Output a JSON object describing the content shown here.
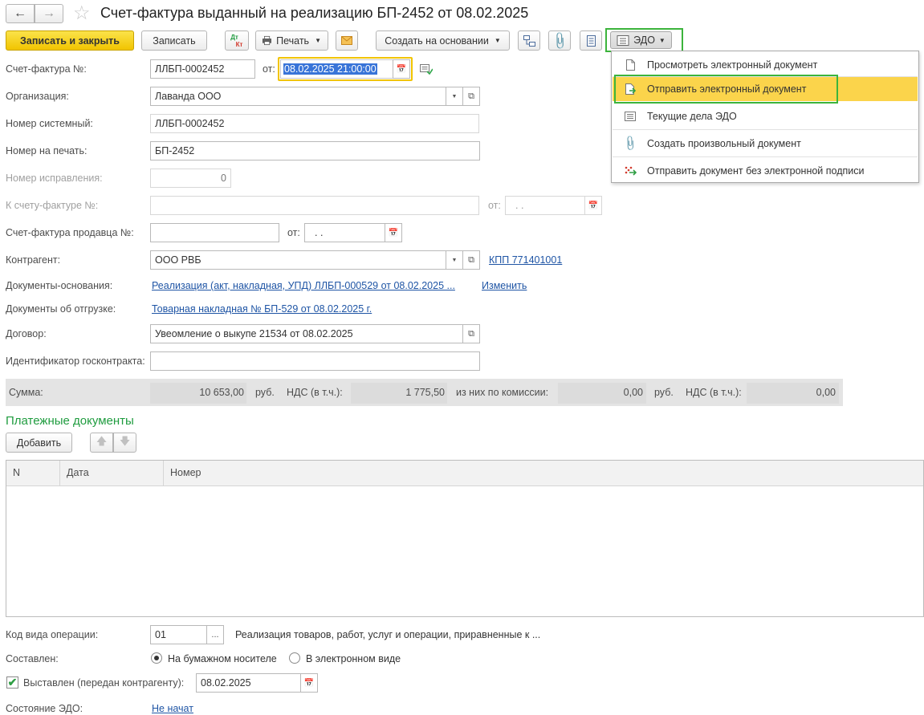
{
  "window": {
    "title": "Счет-фактура выданный на реализацию БП-2452 от 08.02.2025"
  },
  "toolbar": {
    "save_close": "Записать и закрыть",
    "save": "Записать",
    "dt_kt_top": "Дт",
    "dt_kt_bottom": "Кт",
    "print": "Печать",
    "create_based": "Создать на основании",
    "edo": "ЭДО"
  },
  "edo_menu": {
    "items": [
      {
        "label": "Просмотреть электронный документ"
      },
      {
        "label": "Отправить электронный документ"
      },
      {
        "label": "Текущие дела ЭДО"
      },
      {
        "label": "Создать произвольный документ"
      },
      {
        "label": "Отправить документ без электронной подписи"
      }
    ],
    "highlight_color": "#fbd44b",
    "outline_color": "#3cb43c"
  },
  "form": {
    "invoice_no_label": "Счет-фактура №:",
    "invoice_no": "ЛЛБП-0002452",
    "from_label": "от:",
    "date": "08.02.2025 21:00:00",
    "org_label": "Организация:",
    "org": "Лаванда ООО",
    "sys_no_label": "Номер системный:",
    "sys_no": "ЛЛБП-0002452",
    "print_no_label": "Номер на печать:",
    "print_no": "БП-2452",
    "fix_no_label": "Номер исправления:",
    "fix_no": "0",
    "to_invoice_label": "К счету-фактуре №:",
    "to_invoice_from_label": "от:",
    "empty_date": ". .",
    "seller_invoice_label": "Счет-фактура продавца №:",
    "seller_from_label": "от:",
    "contractor_label": "Контрагент:",
    "contractor": "ООО РВБ",
    "kpp_link": "КПП 771401001",
    "base_docs_label": "Документы-основания:",
    "base_docs_link": "Реализация (акт, накладная, УПД) ЛЛБП-000529 от 08.02.2025 ...",
    "change_link": "Изменить",
    "ship_docs_label": "Документы об отгрузке:",
    "ship_docs_link": "Товарная накладная № БП-529 от 08.02.2025 г.",
    "contract_label": "Договор:",
    "contract": "Увеомление о выкупе 21534 от 08.02.2025",
    "gov_id_label": "Идентификатор госконтракта:"
  },
  "sum": {
    "label": "Сумма:",
    "amount": "10 653,00",
    "rub1": "руб.",
    "vat_label": "НДС (в т.ч.):",
    "vat": "1 775,50",
    "commission_label": "из них по комиссии:",
    "commission": "0,00",
    "rub2": "руб.",
    "vat2_label": "НДС (в т.ч.):",
    "vat2": "0,00"
  },
  "payments": {
    "title": "Платежные документы",
    "add": "Добавить",
    "columns": [
      "N",
      "Дата",
      "Номер"
    ]
  },
  "bottom": {
    "op_code_label": "Код вида операции:",
    "op_code": "01",
    "op_dots": "...",
    "op_desc": "Реализация товаров, работ, услуг и операции, приравненные к ...",
    "composed_label": "Составлен:",
    "paper": "На бумажном носителе",
    "electronic": "В электронном виде",
    "issued_label": "Выставлен (передан контрагенту):",
    "issued_date": "08.02.2025",
    "edo_state_label": "Состояние ЭДО:",
    "edo_state": "Не начат"
  },
  "colors": {
    "accent_yellow": "#f1c400",
    "link_blue": "#1f55a5",
    "section_green": "#1f9c3f"
  }
}
